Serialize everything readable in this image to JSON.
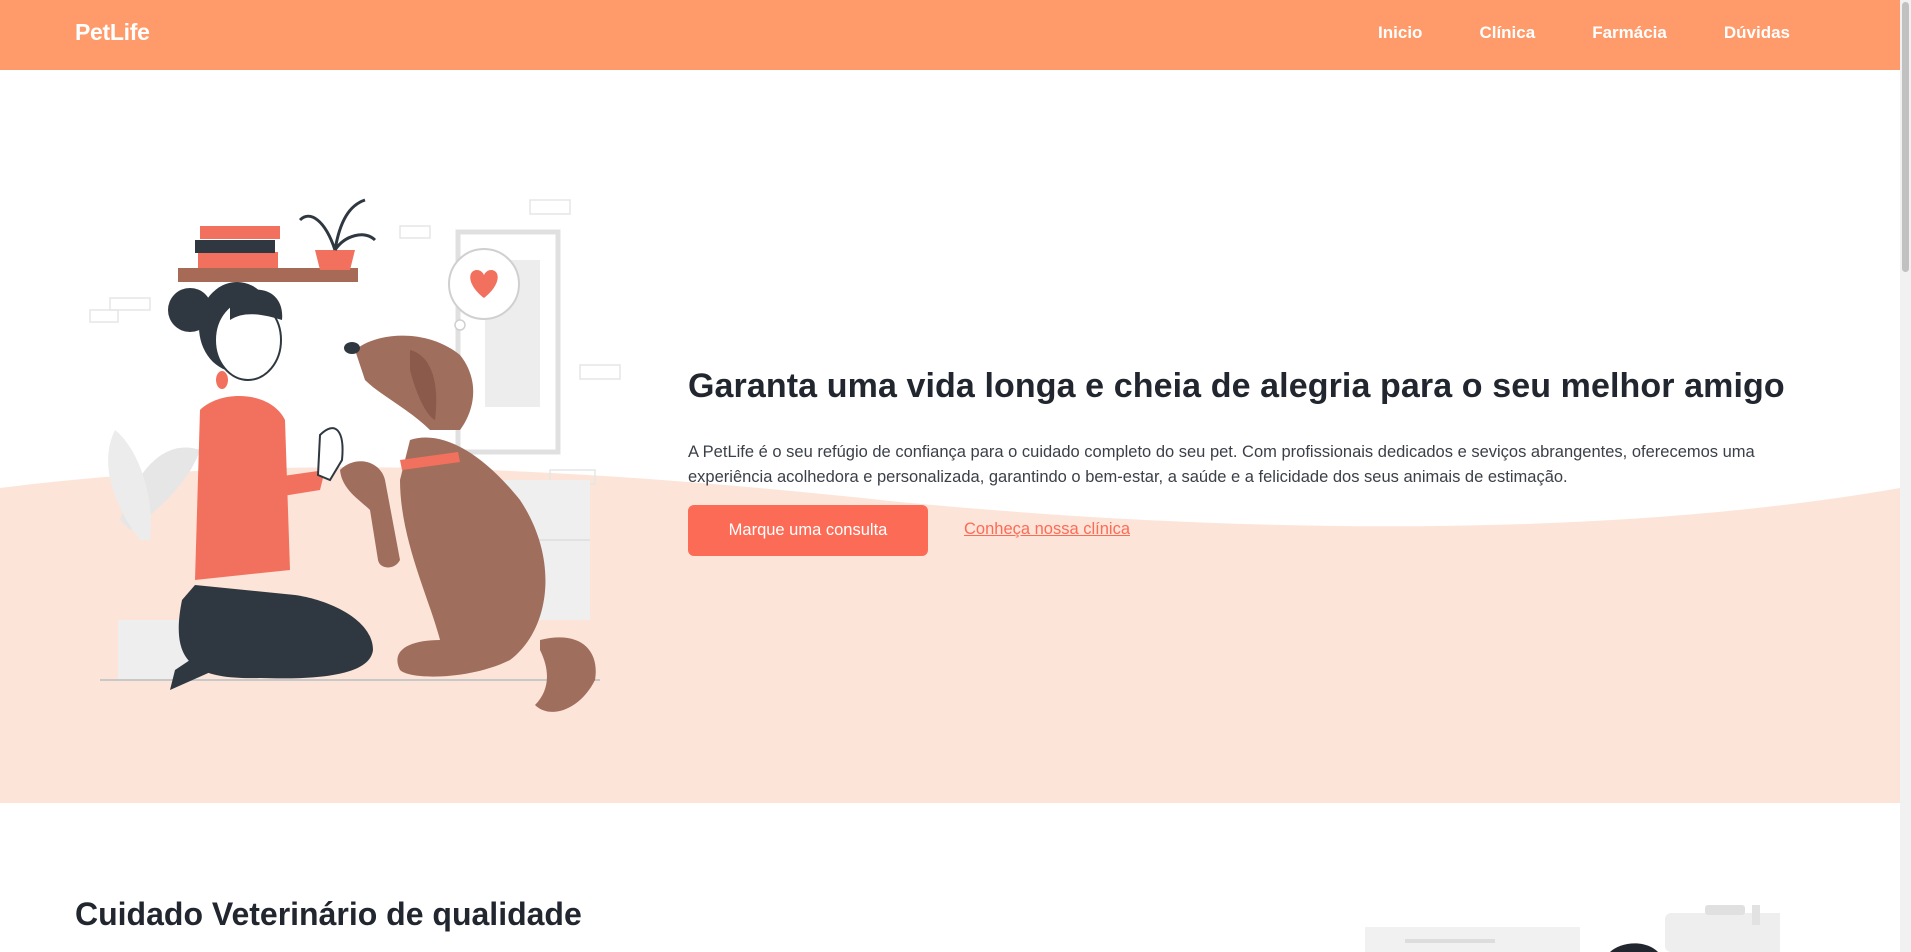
{
  "brand": {
    "name": "PetLife"
  },
  "nav": {
    "items": [
      {
        "label": "Inicio"
      },
      {
        "label": "Clínica"
      },
      {
        "label": "Farmácia"
      },
      {
        "label": "Dúvidas"
      }
    ]
  },
  "hero": {
    "title": "Garanta uma vida longa e cheia de alegria para o seu melhor amigo",
    "description": "A PetLife é o seu refúgio de confiança para o cuidado completo do seu pet. Com profissionais dedicados e seviços abrangentes, oferecemos uma experiência acolhedora e personalizada, garantindo o bem-estar, a saúde e a felicidade dos seus animais de estimação.",
    "primary_button": "Marque uma consulta",
    "secondary_link": "Conheça nossa clínica",
    "illustration_icon": "woman-high-five-dog-illustration"
  },
  "services": {
    "title": "Cuidado Veterinário de qualidade",
    "illustration_icon": "vet-clinic-illustration"
  },
  "colors": {
    "navbar": "#ff9b6a",
    "accent": "#fc6b56",
    "hero_wave": "#fde4d8",
    "text": "#22262f"
  }
}
